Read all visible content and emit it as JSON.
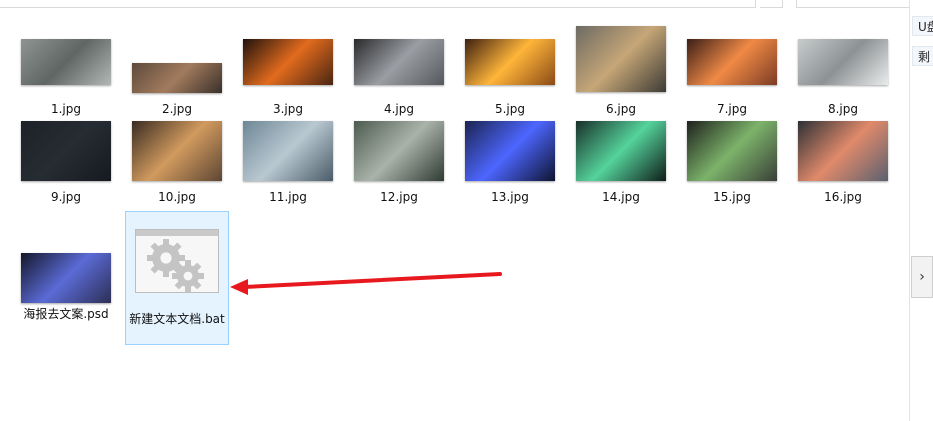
{
  "right_panel": {
    "items": [
      "U盘",
      "剩"
    ],
    "expand_glyph": "›"
  },
  "files": [
    {
      "name": "1.jpg",
      "icon": "image-steel-beams",
      "palette": [
        "#8e9593",
        "#5f6664",
        "#b3b8b5"
      ]
    },
    {
      "name": "2.jpg",
      "icon": "image-factory-hall",
      "palette": [
        "#5d4a3c",
        "#a27b5d",
        "#39302a"
      ]
    },
    {
      "name": "3.jpg",
      "icon": "image-furnace",
      "palette": [
        "#1f120d",
        "#e26b1d",
        "#4a2512"
      ]
    },
    {
      "name": "4.jpg",
      "icon": "image-steel-coils",
      "palette": [
        "#2a2a2c",
        "#9a9ea3",
        "#55585c"
      ]
    },
    {
      "name": "5.jpg",
      "icon": "image-hot-bars",
      "palette": [
        "#3d2010",
        "#ffb53a",
        "#8a4a16"
      ]
    },
    {
      "name": "6.jpg",
      "icon": "image-construction",
      "palette": [
        "#6c6a64",
        "#c6a677",
        "#3d3b36"
      ]
    },
    {
      "name": "7.jpg",
      "icon": "image-molten-pour",
      "palette": [
        "#3a1e18",
        "#f08a45",
        "#7c3b25"
      ]
    },
    {
      "name": "8.jpg",
      "icon": "image-steel-rods",
      "palette": [
        "#c7cbcc",
        "#8d9294",
        "#e9ecec"
      ]
    },
    {
      "name": "9.jpg",
      "icon": "image-dark",
      "palette": [
        "#1d2228",
        "#262c33",
        "#151a1f"
      ]
    },
    {
      "name": "10.jpg",
      "icon": "image-workshop",
      "palette": [
        "#3a2c22",
        "#d19a5e",
        "#5d4634"
      ]
    },
    {
      "name": "11.jpg",
      "icon": "image-metal-sheets",
      "palette": [
        "#6e8796",
        "#b9c8d1",
        "#4a5c68"
      ]
    },
    {
      "name": "12.jpg",
      "icon": "image-grinding",
      "palette": [
        "#4d5b4f",
        "#aab3aa",
        "#2f3a33"
      ]
    },
    {
      "name": "13.jpg",
      "icon": "image-welding-blue",
      "palette": [
        "#1b2450",
        "#4d66ff",
        "#0e1430"
      ]
    },
    {
      "name": "14.jpg",
      "icon": "image-welding-green",
      "palette": [
        "#18302a",
        "#55d39b",
        "#0f1d1a"
      ]
    },
    {
      "name": "15.jpg",
      "icon": "image-welder",
      "palette": [
        "#1e211d",
        "#7cb36a",
        "#3a3f38"
      ]
    },
    {
      "name": "16.jpg",
      "icon": "image-sparks",
      "palette": [
        "#2d3036",
        "#e08a6a",
        "#5a6070"
      ]
    },
    {
      "name": "海报去文案.psd",
      "icon": "image-welding-sparks",
      "palette": [
        "#15172a",
        "#5b6bd6",
        "#2c2f55"
      ]
    },
    {
      "name": "新建文本文档.bat",
      "icon": "gears-icon",
      "palette": [
        "#c4c4c4"
      ]
    }
  ],
  "annotation": {
    "color": "#e8191e",
    "icon": "red-arrow"
  }
}
